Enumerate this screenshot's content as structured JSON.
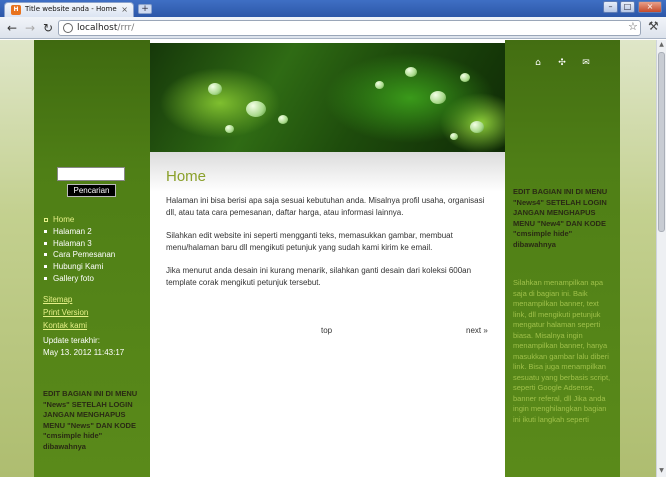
{
  "browser": {
    "tab_title": "Title website anda - Home",
    "new_tab": "+",
    "url_host": "localhost",
    "url_path": "/rrr/",
    "back": "←",
    "forward": "→",
    "reload": "↻",
    "star": "☆",
    "wrench": "⚒",
    "min": "–",
    "max": "□",
    "close": "×"
  },
  "sidebar": {
    "search_value": "",
    "search_button": "Pencarian",
    "nav": [
      "Home",
      "Halaman 2",
      "Halaman 3",
      "Cara Pemesanan",
      "Hubungi Kami",
      "Gallery foto"
    ],
    "links": {
      "sitemap": "Sitemap",
      "print": "Print Version",
      "kontak": "Kontak kami"
    },
    "update_label": "Update terakhir:",
    "update_date": "May 13. 2012 11:43:17",
    "note": "EDIT BAGIAN INI DI MENU \"News\" SETELAH LOGIN JANGAN MENGHAPUS MENU \"News\" DAN KODE \"cmsimple hide\" dibawahnya"
  },
  "main": {
    "title": "Home",
    "p1": "Halaman ini bisa berisi apa saja sesuai kebutuhan anda. Misalnya profil usaha, organisasi dll, atau tata cara pemesanan, daftar harga, atau informasi lainnya.",
    "p2": "Silahkan edit website ini seperti mengganti teks, memasukkan gambar, membuat menu/halaman baru dll mengikuti petunjuk yang sudah kami kirim ke email.",
    "p3": "Jika menurut anda desain ini kurang menarik, silahkan ganti desain dari koleksi 600an template corak mengikuti petunjuk tersebut.",
    "top_link": "top",
    "next_link": "next »"
  },
  "rightbar": {
    "icons": [
      "home-icon",
      "sitemap-icon",
      "mail-icon"
    ],
    "note": "EDIT BAGIAN INI DI MENU \"News4\" SETELAH LOGIN JANGAN MENGHAPUS MENU \"New4\" DAN KODE \"cmsimple hide\" dibawahnya",
    "body": "Silahkan menampilkan apa saja di bagian ini. Baik menampilkan banner, text link, dll mengikuti petunjuk mengatur halaman seperti biasa. Misalnya ingin menampilkan banner, hanya masukkan gambar lalu diberi link. Bisa juga menampilkan sesuatu yang berbasis script, seperti Google Adsense, banner referal, dll Jika anda ingin menghilangkan bagian ini ikuti langkah seperti"
  }
}
